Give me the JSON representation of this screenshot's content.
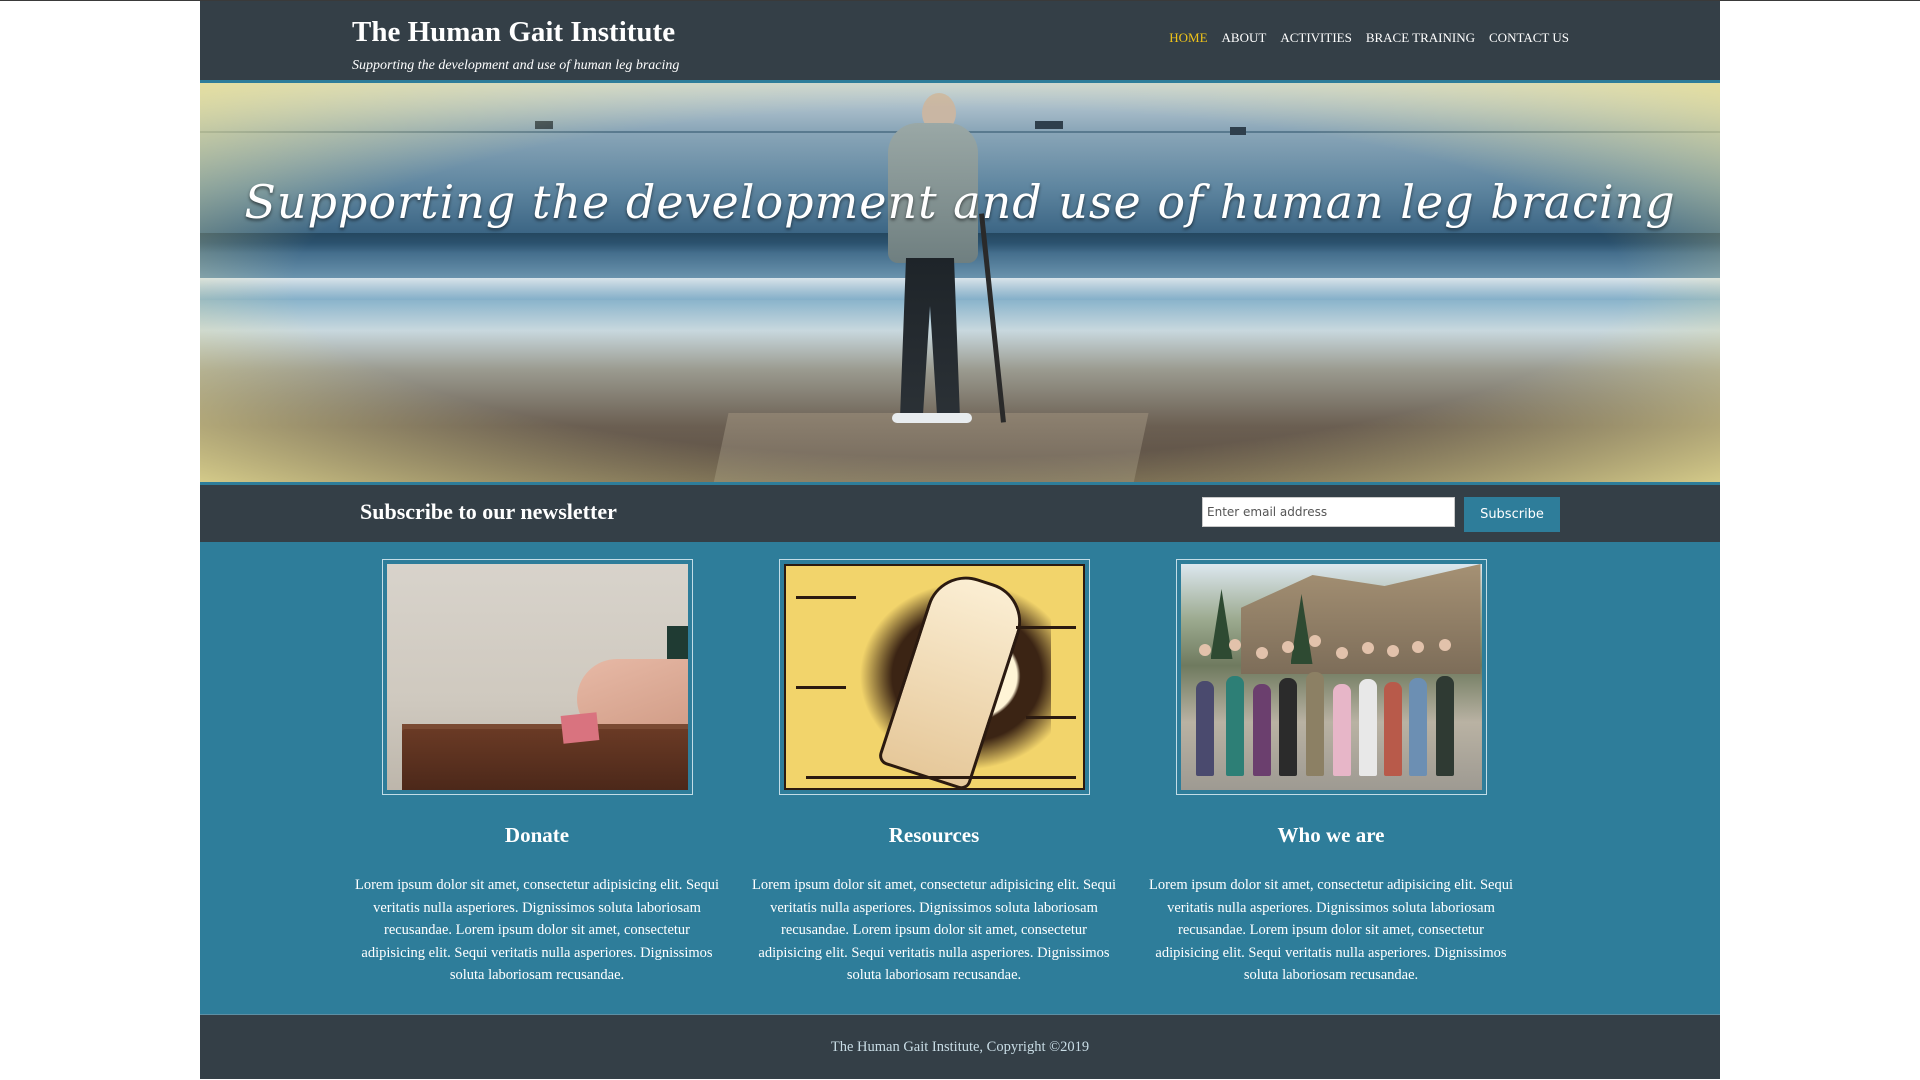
{
  "header": {
    "title": "The Human Gait Institute",
    "tagline": "Supporting the development and use of human leg bracing"
  },
  "nav": {
    "items": [
      {
        "label": "HOME",
        "active": true
      },
      {
        "label": "ABOUT",
        "active": false
      },
      {
        "label": "ACTIVITIES",
        "active": false
      },
      {
        "label": "BRACE TRAINING",
        "active": false
      },
      {
        "label": "CONTACT US",
        "active": false
      }
    ]
  },
  "hero": {
    "script_text": "Supporting the development and use of human leg bracing"
  },
  "newsletter": {
    "heading": "Subscribe to our newsletter",
    "email_placeholder": "Enter email address",
    "button_label": "Subscribe"
  },
  "cards": [
    {
      "title": "Donate",
      "text": "Lorem ipsum dolor sit amet, consectetur adipisicing elit. Sequi veritatis nulla asperiores. Dignissimos soluta laboriosam recusandae. Lorem ipsum dolor sit amet, consectetur adipisicing elit. Sequi veritatis nulla asperiores. Dignissimos soluta laboriosam recusandae."
    },
    {
      "title": "Resources",
      "text": "Lorem ipsum dolor sit amet, consectetur adipisicing elit. Sequi veritatis nulla asperiores. Dignissimos soluta laboriosam recusandae. Lorem ipsum dolor sit amet, consectetur adipisicing elit. Sequi veritatis nulla asperiores. Dignissimos soluta laboriosam recusandae."
    },
    {
      "title": "Who we are",
      "text": "Lorem ipsum dolor sit amet, consectetur adipisicing elit. Sequi veritatis nulla asperiores. Dignissimos soluta laboriosam recusandae. Lorem ipsum dolor sit amet, consectetur adipisicing elit. Sequi veritatis nulla asperiores. Dignissimos soluta laboriosam recusandae."
    }
  ],
  "footer": {
    "copyright": "The Human Gait Institute, Copyright ©2019"
  },
  "colors": {
    "dark_panel": "#343f47",
    "teal": "#2e7d9a",
    "nav_active": "#f0c419",
    "white": "#ffffff"
  }
}
